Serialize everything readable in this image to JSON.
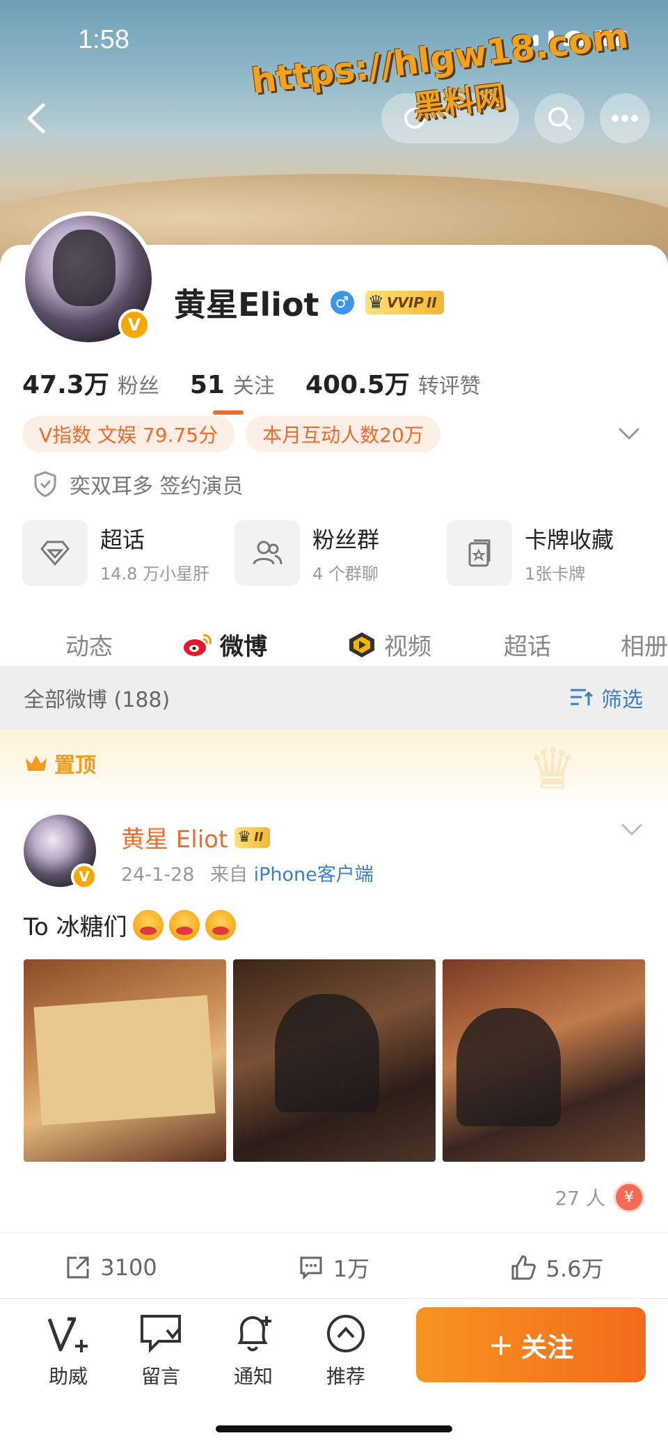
{
  "status_bar": {
    "time": "1:58"
  },
  "watermark": {
    "url": "https://hlgw18.com",
    "text": "黑料网"
  },
  "profile": {
    "name": "黄星Eliot",
    "vip_label": "VVIP",
    "vip_level": "II",
    "stats": [
      {
        "num": "47.3万",
        "label": "粉丝"
      },
      {
        "num": "51",
        "label": "关注"
      },
      {
        "num": "400.5万",
        "label": "转评赞"
      }
    ],
    "tags": [
      "V指数 文娱 79.75分",
      "本月互动人数20万"
    ],
    "certification": "奕双耳多 签约演员",
    "shortcuts": [
      {
        "title": "超话",
        "sub": "14.8 万小星肝"
      },
      {
        "title": "粉丝群",
        "sub": "4 个群聊"
      },
      {
        "title": "卡牌收藏",
        "sub": "1张卡牌"
      }
    ],
    "tabs": [
      "动态",
      "微博",
      "视频",
      "超话",
      "相册"
    ]
  },
  "filter": {
    "count_label": "全部微博 (188)",
    "filter_label": "筛选"
  },
  "pinned": {
    "label": "置顶"
  },
  "post": {
    "author": "黄星 Eliot",
    "vip_level": "II",
    "date": "24-1-28",
    "source_prefix": "来自",
    "source": "iPhone客户端",
    "text": "To 冰糖们",
    "reward_count": "27 人",
    "reposts": "3100",
    "comments": "1万",
    "likes": "5.6万"
  },
  "bottom_bar": {
    "items": [
      "助威",
      "留言",
      "通知",
      "推荐"
    ],
    "follow_label": "关注"
  },
  "colors": {
    "accent": "#f26a2a",
    "link": "#3d7fc4",
    "follow_start": "#f79420",
    "follow_end": "#f36b1c"
  }
}
